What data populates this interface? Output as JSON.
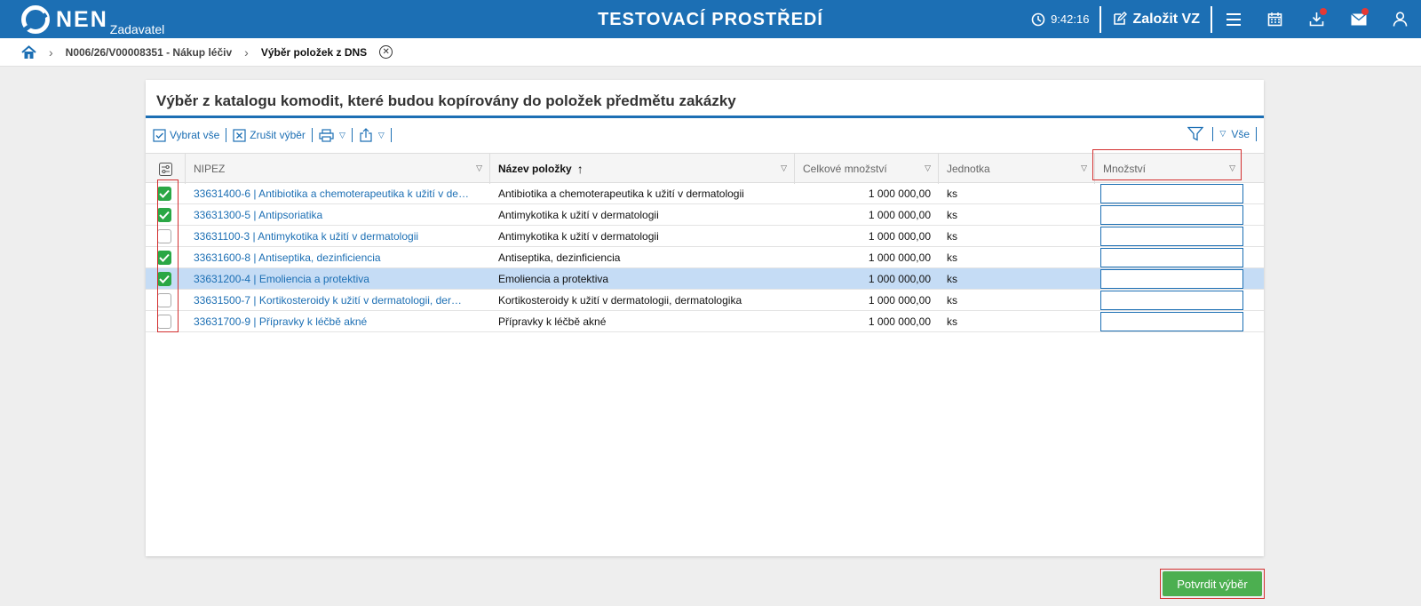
{
  "header": {
    "logo_text": "NEN",
    "logo_sub": "Zadavatel",
    "environment_title": "TESTOVACÍ PROSTŘEDÍ",
    "time": "9:42:16",
    "create_label": "Založit VZ"
  },
  "breadcrumb": {
    "parent": "N006/26/V00008351 - Nákup léčiv",
    "current": "Výběr položek z DNS"
  },
  "card": {
    "title": "Výběr z katalogu komodit, které budou kopírovány do položek předmětu zakázky"
  },
  "toolbar": {
    "select_all": "Vybrat vše",
    "clear_selection": "Zrušit výběr",
    "filter_all": "Vše"
  },
  "table": {
    "columns": [
      {
        "key": "nipez",
        "label": "NIPEZ"
      },
      {
        "key": "name",
        "label": "Název položky"
      },
      {
        "key": "total",
        "label": "Celkové množství"
      },
      {
        "key": "unit",
        "label": "Jednotka"
      },
      {
        "key": "qty",
        "label": "Množství"
      }
    ],
    "rows": [
      {
        "checked": true,
        "selected": false,
        "nipez": "33631400-6 | Antibiotika a chemoterapeutika k užití v de…",
        "name": "Antibiotika a chemoterapeutika k užití v dermatologii",
        "total": "1 000 000,00",
        "unit": "ks",
        "qty": ""
      },
      {
        "checked": true,
        "selected": false,
        "nipez": "33631300-5 | Antipsoriatika",
        "name": "Antimykotika k užití v dermatologii",
        "total": "1 000 000,00",
        "unit": "ks",
        "qty": ""
      },
      {
        "checked": false,
        "selected": false,
        "nipez": "33631100-3 | Antimykotika k užití v dermatologii",
        "name": "Antimykotika k užití v dermatologii",
        "total": "1 000 000,00",
        "unit": "ks",
        "qty": ""
      },
      {
        "checked": true,
        "selected": false,
        "nipez": "33631600-8 | Antiseptika, dezinficiencia",
        "name": "Antiseptika, dezinficiencia",
        "total": "1 000 000,00",
        "unit": "ks",
        "qty": ""
      },
      {
        "checked": true,
        "selected": true,
        "nipez": "33631200-4 | Emoliencia a protektiva",
        "name": "Emoliencia a protektiva",
        "total": "1 000 000,00",
        "unit": "ks",
        "qty": ""
      },
      {
        "checked": false,
        "selected": false,
        "nipez": "33631500-7 | Kortikosteroidy k užití v dermatologii, der…",
        "name": "Kortikosteroidy k užití v dermatologii, dermatologika",
        "total": "1 000 000,00",
        "unit": "ks",
        "qty": ""
      },
      {
        "checked": false,
        "selected": false,
        "nipez": "33631700-9 | Přípravky k léčbě akné",
        "name": "Přípravky k léčbě akné",
        "total": "1 000 000,00",
        "unit": "ks",
        "qty": ""
      }
    ]
  },
  "footer": {
    "confirm_label": "Potvrdit výběr"
  },
  "colors": {
    "brand": "#1c6fb4",
    "checked": "#2aa745",
    "confirm": "#4caf50",
    "highlight": "#d32f2f",
    "selected_row": "#c5dcf5"
  },
  "icons": [
    "home-icon",
    "chevron-right-icon",
    "close-circle-icon",
    "clock-icon",
    "edit-icon",
    "menu-icon",
    "calendar-icon",
    "download-icon",
    "mail-icon",
    "user-icon",
    "filter-icon",
    "print-icon",
    "export-icon",
    "column-settings-icon",
    "sort-asc-icon"
  ]
}
